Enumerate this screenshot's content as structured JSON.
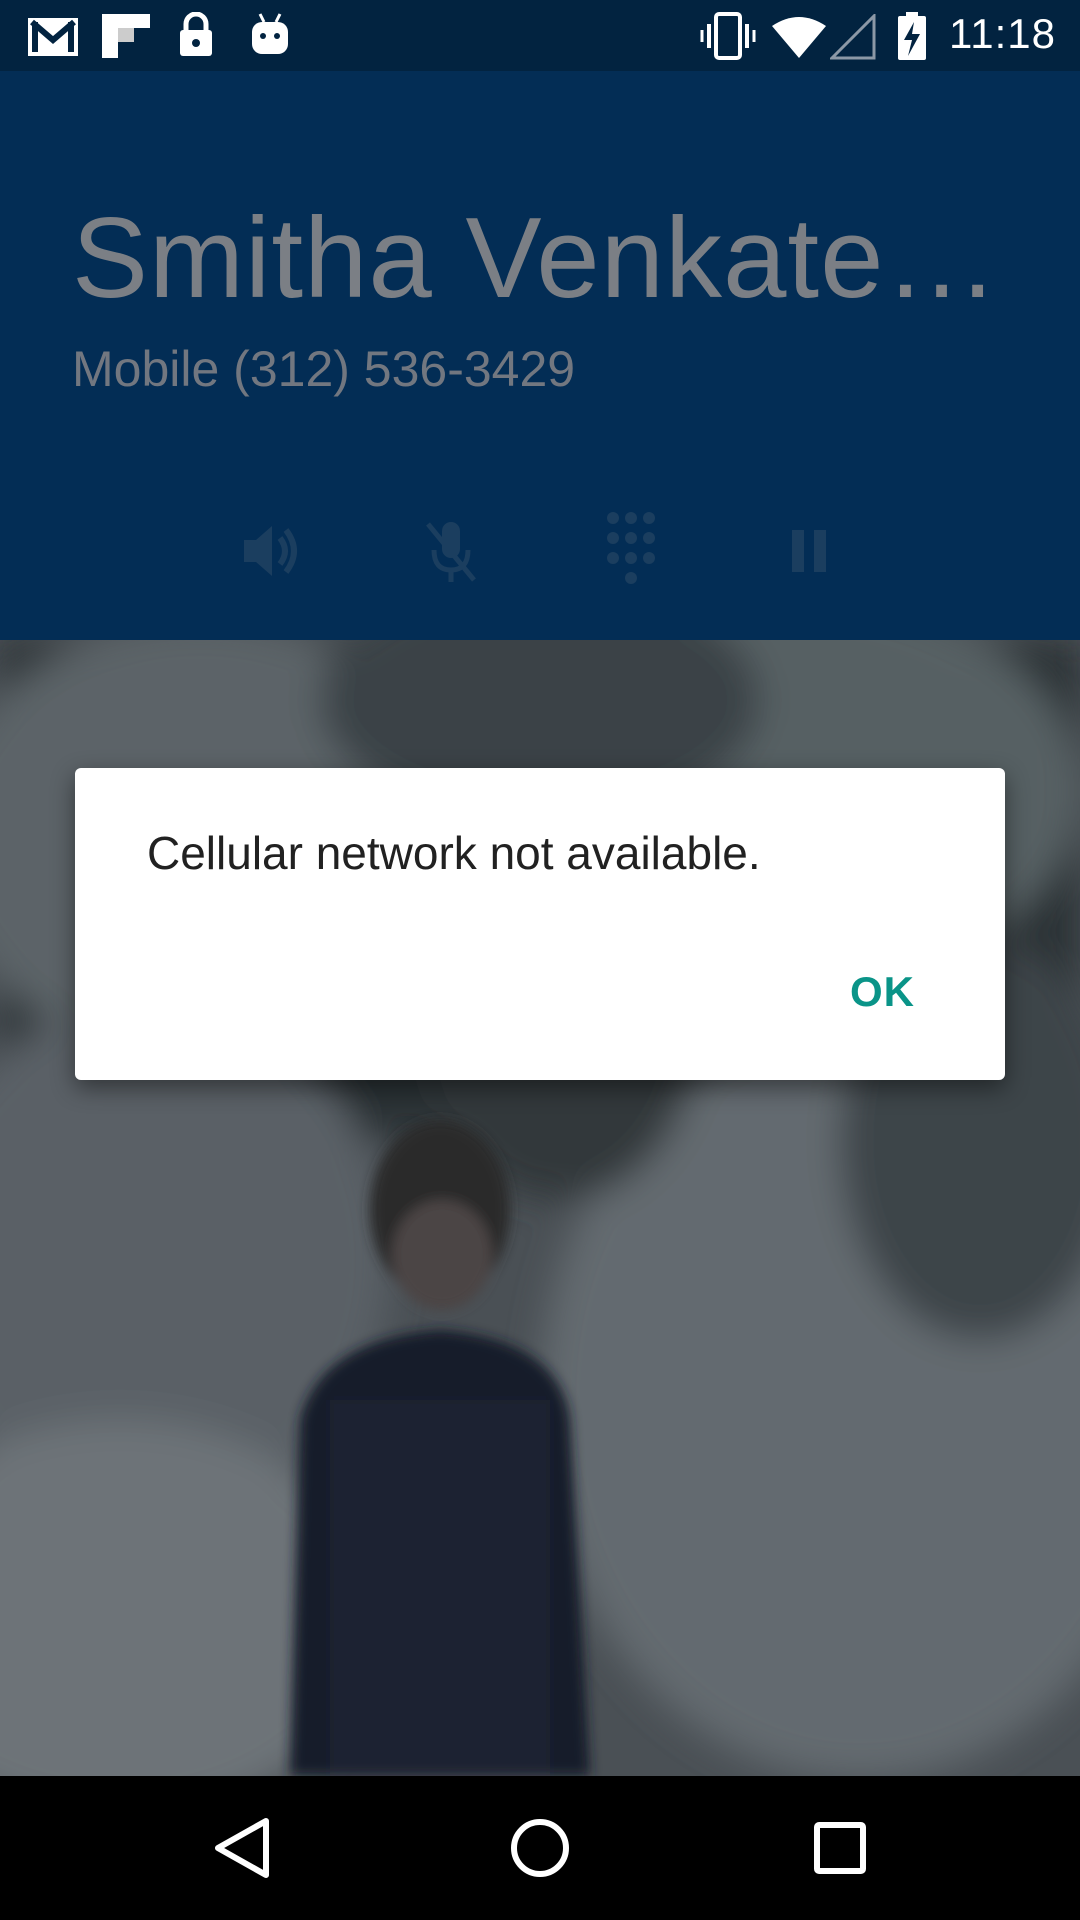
{
  "status_bar": {
    "time": "11:18",
    "background": "#022340",
    "left_icons": [
      "gmail-icon",
      "flipboard-icon",
      "lock-icon",
      "android-icon"
    ],
    "right_icons": [
      "vibrate-icon",
      "wifi-icon",
      "cell-signal-icon",
      "battery-charging-icon"
    ]
  },
  "call": {
    "caller_name": "Smitha Venkate…",
    "caller_sub": "Mobile (312) 536-3429",
    "header_color": "#032d55",
    "buttons": [
      "speaker-icon",
      "mute-icon",
      "dialpad-icon",
      "pause-icon"
    ]
  },
  "dialog": {
    "message": "Cellular network not available.",
    "ok_label": "OK",
    "accent": "#0a9488"
  },
  "nav_bar": {
    "buttons": [
      "back-icon",
      "home-icon",
      "recents-icon"
    ]
  }
}
